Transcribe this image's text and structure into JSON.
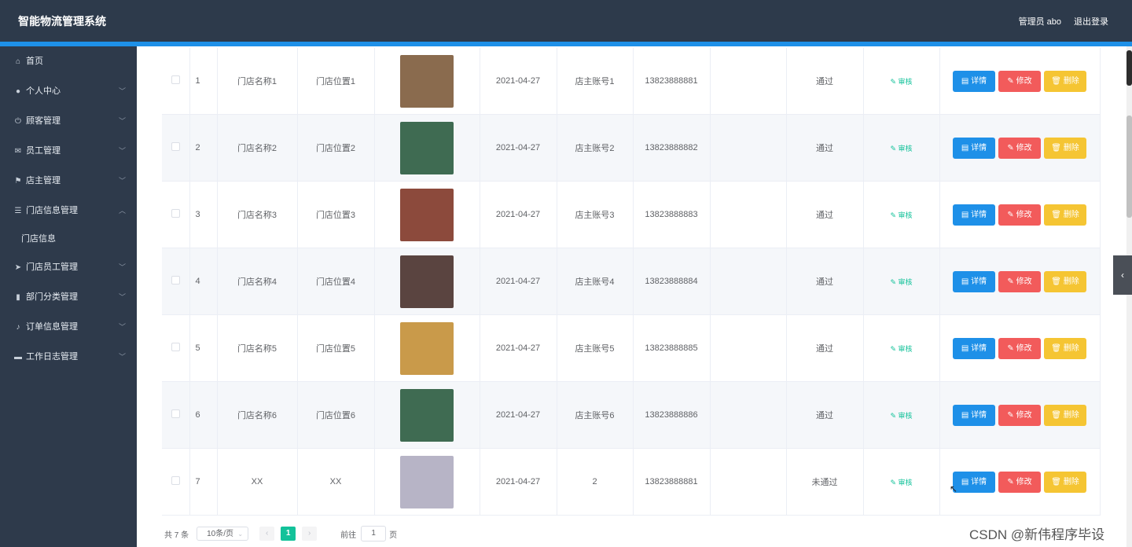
{
  "header": {
    "title": "智能物流管理系统",
    "user": "管理员 abo",
    "logout": "退出登录"
  },
  "sidebar": {
    "items": [
      {
        "label": "首页",
        "icon": "home-icon",
        "glyph": "⌂",
        "has_children": false
      },
      {
        "label": "个人中心",
        "icon": "user-icon",
        "glyph": "●",
        "has_children": true
      },
      {
        "label": "顾客管理",
        "icon": "power-icon",
        "glyph": "⏻",
        "has_children": true
      },
      {
        "label": "员工管理",
        "icon": "mail-icon",
        "glyph": "✉",
        "has_children": true
      },
      {
        "label": "店主管理",
        "icon": "flag-icon",
        "glyph": "⚑",
        "has_children": true
      },
      {
        "label": "门店信息管理",
        "icon": "menu-icon",
        "glyph": "☰",
        "has_children": true,
        "expanded": true
      },
      {
        "label": "门店信息",
        "sub": true
      },
      {
        "label": "门店员工管理",
        "icon": "send-icon",
        "glyph": "➤",
        "has_children": true
      },
      {
        "label": "部门分类管理",
        "icon": "chart-icon",
        "glyph": "▮",
        "has_children": true
      },
      {
        "label": "订单信息管理",
        "icon": "bell-icon",
        "glyph": "♪",
        "has_children": true
      },
      {
        "label": "工作日志管理",
        "icon": "message-icon",
        "glyph": "▬",
        "has_children": true
      }
    ]
  },
  "table": {
    "rows": [
      {
        "no": "1",
        "name": "门店名称1",
        "location": "门店位置1",
        "date": "2021-04-27",
        "account": "店主账号1",
        "phone": "13823888881",
        "note": "",
        "status": "通过",
        "image_color": "#8a6b4e"
      },
      {
        "no": "2",
        "name": "门店名称2",
        "location": "门店位置2",
        "date": "2021-04-27",
        "account": "店主账号2",
        "phone": "13823888882",
        "note": "",
        "status": "通过",
        "image_color": "#3f6b52"
      },
      {
        "no": "3",
        "name": "门店名称3",
        "location": "门店位置3",
        "date": "2021-04-27",
        "account": "店主账号3",
        "phone": "13823888883",
        "note": "",
        "status": "通过",
        "image_color": "#8c4a3c"
      },
      {
        "no": "4",
        "name": "门店名称4",
        "location": "门店位置4",
        "date": "2021-04-27",
        "account": "店主账号4",
        "phone": "13823888884",
        "note": "",
        "status": "通过",
        "image_color": "#5a4440"
      },
      {
        "no": "5",
        "name": "门店名称5",
        "location": "门店位置5",
        "date": "2021-04-27",
        "account": "店主账号5",
        "phone": "13823888885",
        "note": "",
        "status": "通过",
        "image_color": "#c99a4a"
      },
      {
        "no": "6",
        "name": "门店名称6",
        "location": "门店位置6",
        "date": "2021-04-27",
        "account": "店主账号6",
        "phone": "13823888886",
        "note": "",
        "status": "通过",
        "image_color": "#3f6b52"
      },
      {
        "no": "7",
        "name": "XX",
        "location": "XX",
        "date": "2021-04-27",
        "account": "2",
        "phone": "13823888881",
        "note": "",
        "status": "未通过",
        "image_color": "#b7b4c6"
      }
    ],
    "audit_label": "审核",
    "detail_label": "详情",
    "edit_label": "修改",
    "delete_label": "删除"
  },
  "pagination": {
    "total": "共 7 条",
    "page_size": "10条/页",
    "current_page": "1",
    "goto_label": "前往",
    "goto_value": "1",
    "page_unit": "页"
  },
  "watermark": "CSDN @新伟程序毕设"
}
